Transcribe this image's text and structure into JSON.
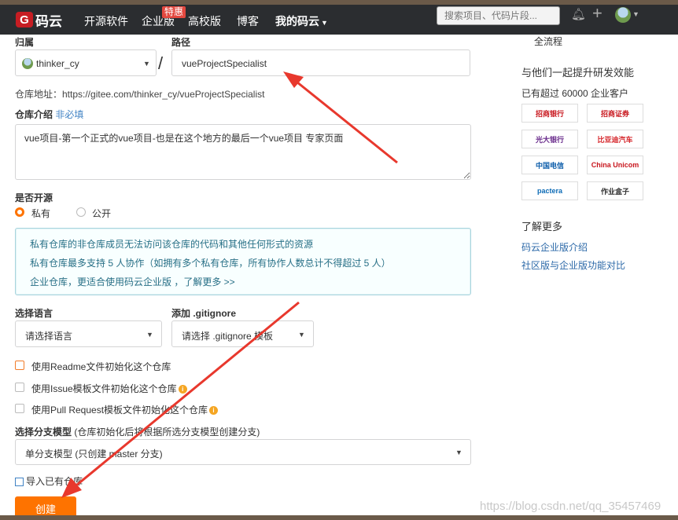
{
  "nav": {
    "logo_text": "码云",
    "logo_badge": "G",
    "items": [
      "开源软件",
      "企业版",
      "高校版",
      "博客"
    ],
    "badge": "特惠",
    "mine": "我的码云",
    "search_placeholder": "搜索项目、代码片段..."
  },
  "form": {
    "owner_label": "归属",
    "path_label": "路径",
    "owner_value": "thinker_cy",
    "path_value": "vueProjectSpecialist",
    "repo_url": "仓库地址：https://gitee.com/thinker_cy/vueProjectSpecialist",
    "intro_label": "仓库介绍",
    "intro_optional": "非必填",
    "intro_value": "vue项目-第一个正式的vue项目-也是在这个地方的最后一个vue项目 专家页面",
    "open_label": "是否开源",
    "private_label": "私有",
    "public_label": "公开",
    "info_lines": [
      "私有仓库的非仓库成员无法访问该仓库的代码和其他任何形式的资源",
      "私有仓库最多支持 5 人协作（如拥有多个私有仓库，所有协作人数总计不得超过 5 人）",
      "企业仓库，更适合使用码云企业版 ，了解更多 >>"
    ],
    "lang_label": "选择语言",
    "lang_value": "请选择语言",
    "gitignore_label": "添加 .gitignore",
    "gitignore_value": "请选择 .gitignore 模板",
    "checks": [
      "使用Readme文件初始化这个仓库",
      "使用Issue模板文件初始化这个仓库",
      "使用Pull Request模板文件初始化这个仓库"
    ],
    "branch_label": "选择分支模型",
    "branch_hint": "(仓库初始化后将根据所选分支模型创建分支)",
    "branch_value": "单分支模型 (只创建 master 分支)",
    "import_link": "导入已有仓库",
    "create_button": "创建"
  },
  "sidebar": {
    "flow": "全流程",
    "heading": "与他们一起提升研发效能",
    "customers": "已有超过 60000 企业客户",
    "logos": [
      "招商银行",
      "招商证券",
      "光大银行",
      "比亚迪汽车",
      "中国电信",
      "China Unicom",
      "pactera",
      "作业盒子"
    ],
    "learn_more": "了解更多",
    "links": [
      "码云企业版介绍",
      "社区版与企业版功能对比"
    ]
  },
  "watermark": "https://blog.csdn.net/qq_35457469",
  "colors": {
    "accent": "#fe7300",
    "brand": "#c71d23",
    "link": "#2c69a8",
    "arrow": "#e8382d"
  }
}
